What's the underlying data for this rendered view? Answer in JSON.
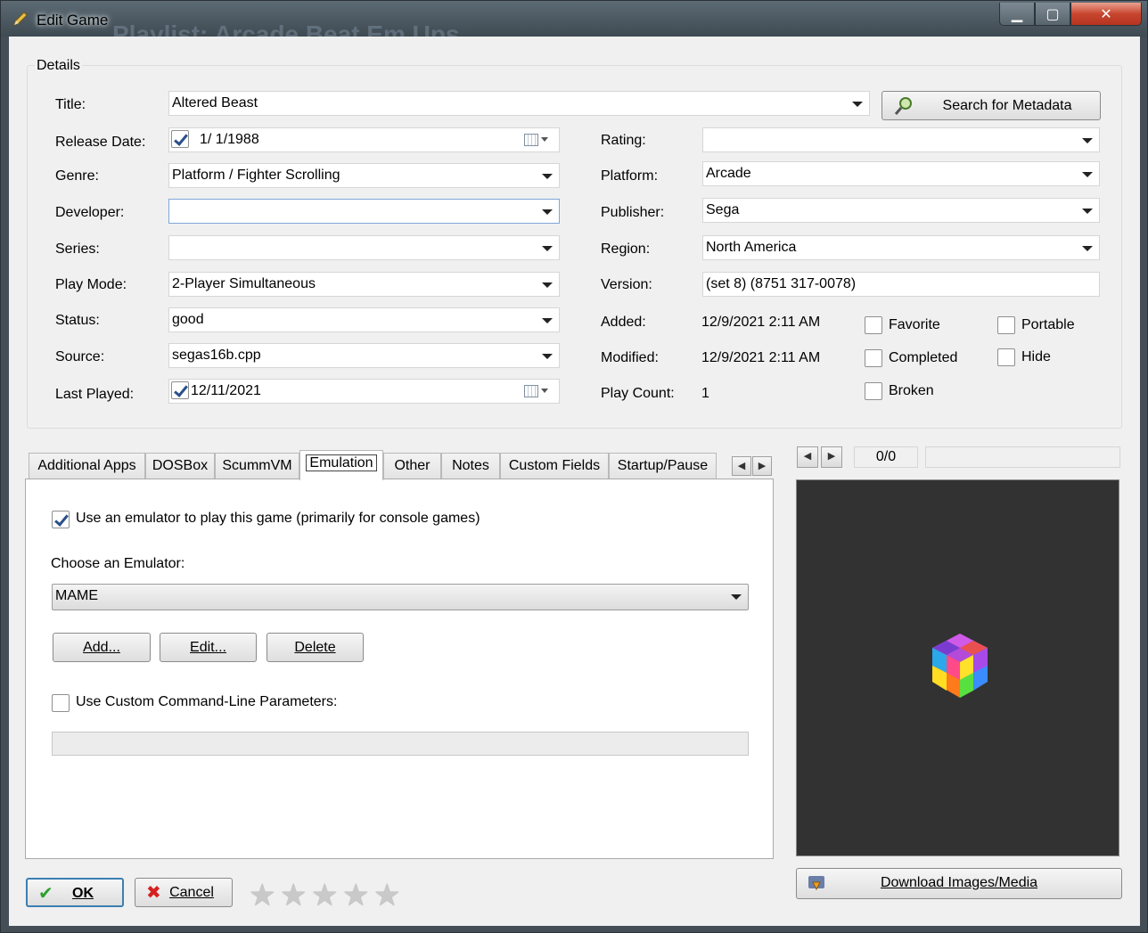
{
  "window": {
    "title": "Edit Game",
    "background_title": "Playlist: Arcade Beat Em Ups"
  },
  "details": {
    "group_label": "Details",
    "title_label": "Title:",
    "title_value": "Altered Beast",
    "search_button": "Search for Metadata",
    "release_date_label": "Release Date:",
    "release_date_value": "1/  1/1988",
    "release_date_checked": true,
    "genre_label": "Genre:",
    "genre_value": "Platform / Fighter Scrolling",
    "developer_label": "Developer:",
    "developer_value": "",
    "series_label": "Series:",
    "series_value": "",
    "play_mode_label": "Play Mode:",
    "play_mode_value": "2-Player Simultaneous",
    "status_label": "Status:",
    "status_value": "good",
    "source_label": "Source:",
    "source_value": "segas16b.cpp",
    "last_played_label": "Last Played:",
    "last_played_value": "12/11/2021",
    "last_played_checked": true,
    "rating_label": "Rating:",
    "rating_value": "",
    "platform_label": "Platform:",
    "platform_value": "Arcade",
    "publisher_label": "Publisher:",
    "publisher_value": "Sega",
    "region_label": "Region:",
    "region_value": "North America",
    "version_label": "Version:",
    "version_value": "(set 8) (8751 317-0078)",
    "added_label": "Added:",
    "added_value": "12/9/2021 2:11 AM",
    "modified_label": "Modified:",
    "modified_value": "12/9/2021 2:11 AM",
    "play_count_label": "Play Count:",
    "play_count_value": "1",
    "checkboxes": {
      "favorite": "Favorite",
      "completed": "Completed",
      "broken": "Broken",
      "portable": "Portable",
      "hide": "Hide"
    }
  },
  "tabs": [
    "Additional Apps",
    "DOSBox",
    "ScummVM",
    "Emulation",
    "Other",
    "Notes",
    "Custom Fields",
    "Startup/Pause"
  ],
  "active_tab": "Emulation",
  "emulation": {
    "use_emulator_label": "Use an emulator to play this game (primarily for console games)",
    "use_emulator_checked": true,
    "choose_label": "Choose an Emulator:",
    "emulator_value": "MAME",
    "add_button": "Add...",
    "edit_button": "Edit...",
    "delete_button": "Delete",
    "custom_params_label": "Use Custom Command-Line Parameters:",
    "custom_params_checked": false,
    "custom_params_value": ""
  },
  "media": {
    "counter": "0/0",
    "download_button": "Download Images/Media"
  },
  "footer": {
    "ok_button": "OK",
    "cancel_button": "Cancel",
    "stars_filled": 0,
    "stars_total": 5
  },
  "colors": {
    "accent_check": "#2b4f8c",
    "image_bg": "#323232"
  }
}
